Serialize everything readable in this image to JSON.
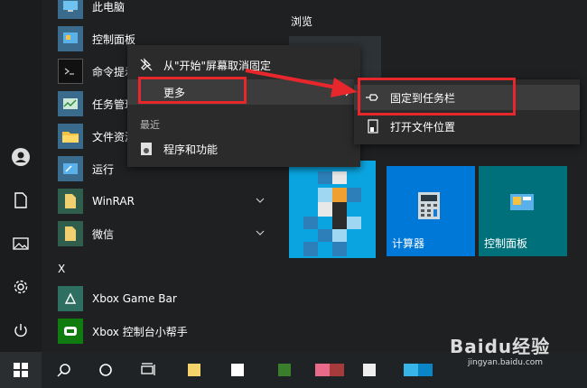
{
  "app_list": {
    "items": [
      {
        "label": "此电脑"
      },
      {
        "label": "控制面板"
      },
      {
        "label": "命令提示符"
      },
      {
        "label": "任务管理器"
      },
      {
        "label": "文件资源管理器"
      },
      {
        "label": "运行"
      },
      {
        "label": "WinRAR"
      },
      {
        "label": "微信"
      },
      {
        "label": "Xbox Game Bar"
      },
      {
        "label": "Xbox 控制台小帮手"
      }
    ],
    "letter_x": "X"
  },
  "tiles": {
    "group_title": "浏览",
    "calculator_label": "计算器",
    "control_panel_label": "控制面板"
  },
  "context_menu": {
    "unpin_label": "从\"开始\"屏幕取消固定",
    "more_label": "更多",
    "recent_header": "最近",
    "programs_label": "程序和功能"
  },
  "submenu": {
    "pin_taskbar_label": "固定到任务栏",
    "open_location_label": "打开文件位置"
  },
  "watermark": {
    "brand": "Baidu经验",
    "url": "jingyan.baidu.com"
  },
  "colors": {
    "accent_red": "#e8272d",
    "tile_blue": "#0078d7",
    "tile_teal": "#00717a"
  }
}
